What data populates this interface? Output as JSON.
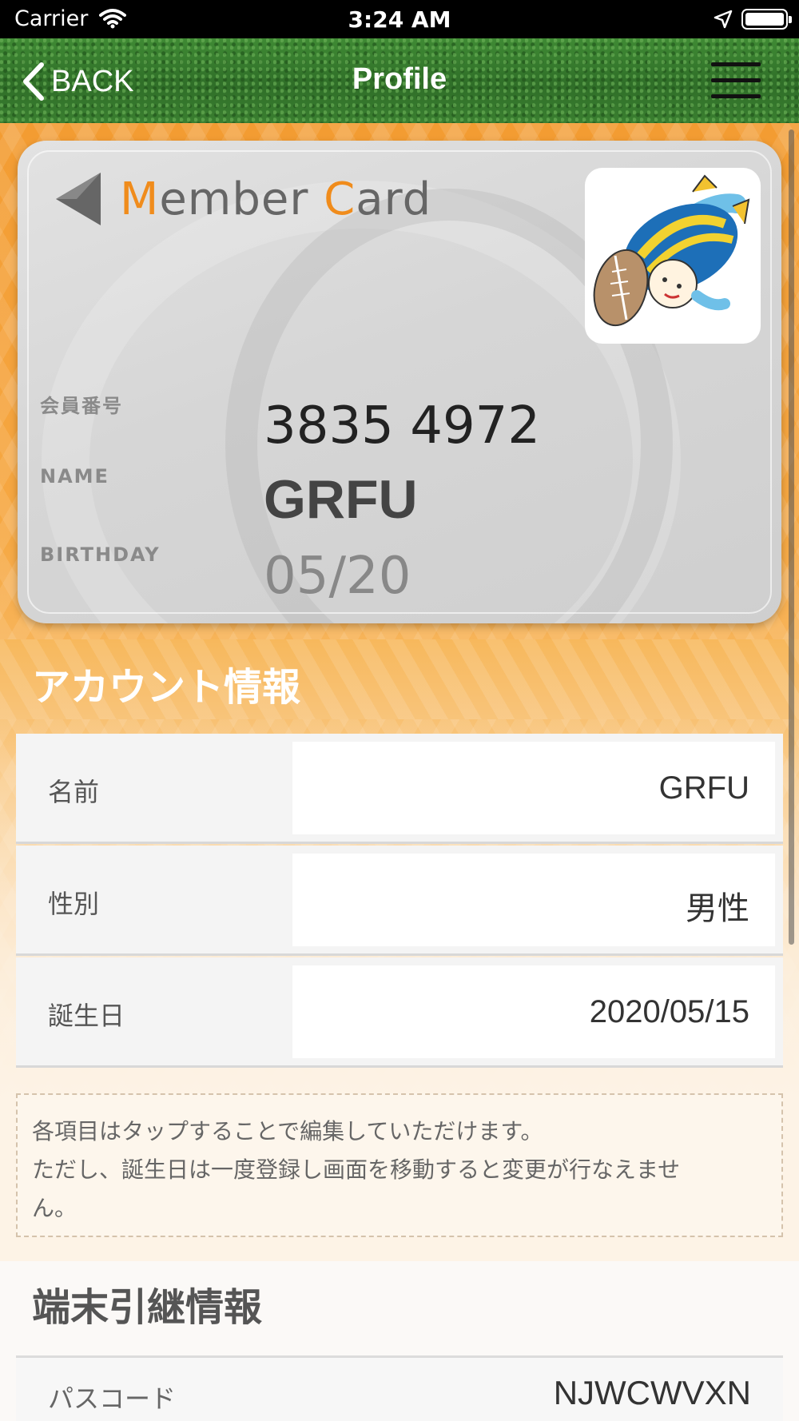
{
  "status_bar": {
    "carrier": "Carrier",
    "time": "3:24 AM"
  },
  "nav": {
    "back_label": "BACK",
    "title": "Profile"
  },
  "card": {
    "logo_m": "M",
    "logo_rest1": "ember ",
    "logo_c": "C",
    "logo_rest2": "ard",
    "member_no_label": "会員番号",
    "member_no": "3835 4972",
    "name_label": "NAME",
    "name": "GRFU",
    "birthday_label": "BIRTHDAY",
    "birthday": "05/20",
    "accent_color": "#f08c1c"
  },
  "account": {
    "header": "アカウント情報",
    "rows": [
      {
        "label": "名前",
        "value": "GRFU"
      },
      {
        "label": "性別",
        "value": "男性"
      },
      {
        "label": "誕生日",
        "value": "2020/05/15"
      }
    ],
    "notice_line1": "各項目はタップすることで編集していただけます。",
    "notice_line2": "ただし、誕生日は一度登録し画面を移動すると変更が行なえませ",
    "notice_line3": "ん。"
  },
  "transfer": {
    "header": "端末引継情報",
    "passcode_label": "パスコード",
    "passcode": "NJWCWVXN"
  }
}
